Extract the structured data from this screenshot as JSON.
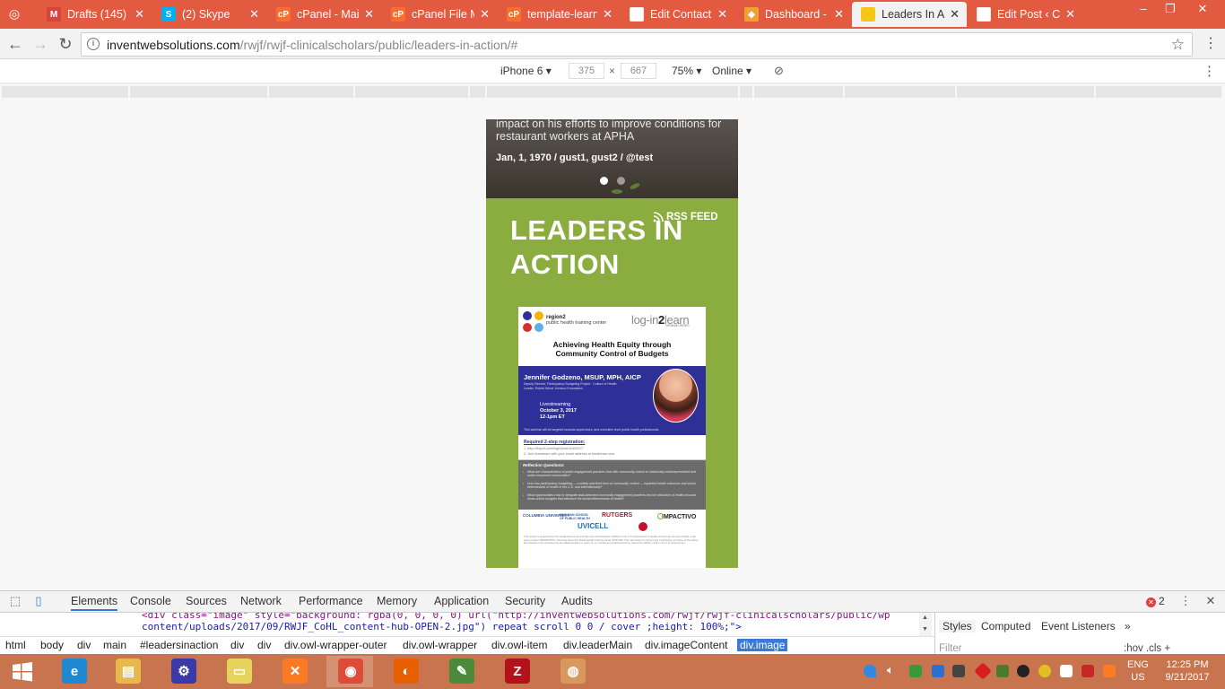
{
  "browser": {
    "tabs": [
      {
        "title": "Drafts (145)",
        "favicon": "gmail-icon",
        "color": "#d44638",
        "glyph": "M"
      },
      {
        "title": "(2) Skype",
        "favicon": "skype-icon",
        "color": "#00aff0",
        "glyph": "S"
      },
      {
        "title": "cPanel - Main",
        "favicon": "cpanel-icon",
        "color": "#ff6c2c",
        "glyph": "cP"
      },
      {
        "title": "cPanel File Manager",
        "favicon": "cpanel-icon",
        "color": "#ff6c2c",
        "glyph": "cP"
      },
      {
        "title": "template-learn",
        "favicon": "cpanel-icon",
        "color": "#ff6c2c",
        "glyph": "cP"
      },
      {
        "title": "Edit Contact",
        "favicon": "page-icon",
        "color": "#ffffff",
        "glyph": ""
      },
      {
        "title": "Dashboard -",
        "favicon": "dashboard-icon",
        "color": "#f0a030",
        "glyph": "◆"
      },
      {
        "title": "Leaders In Action",
        "favicon": "page-yellow-icon",
        "color": "#f5c518",
        "glyph": "",
        "active": true
      },
      {
        "title": "Edit Post ‹ Cl",
        "favicon": "page-icon",
        "color": "#ffffff",
        "glyph": ""
      }
    ],
    "url_host": "inventwebsolutions.com",
    "url_path": "/rwjf/rwjf-clinicalscholars/public/leaders-in-action/#"
  },
  "device_toolbar": {
    "device": "iPhone 6",
    "width": "375",
    "height": "667",
    "zoom": "75%",
    "network": "Online"
  },
  "page": {
    "hero_caption": "impact on his efforts to improve conditions for restaurant workers at APHA",
    "hero_meta": "Jan, 1, 1970  /  gust1, gust2  /  @test",
    "section_title": "LEADERS IN ACTION",
    "rss_label": "RSS FEED",
    "colors": {
      "green": "#8bad3f",
      "flyer_blue": "#2e3097"
    }
  },
  "flyer": {
    "org_name": "region2",
    "org_sub": "public health training center",
    "series_pre": "log-in",
    "series_num": "2",
    "series_post": "learn",
    "series_tag": "WEBINAR SERIES",
    "headline_1": "Achieving Health Equity through",
    "headline_2": "Community Control of Budgets",
    "speaker": "Jennifer Godzeno, MSUP, MPH, AICP",
    "speaker_role": "Deputy Director, Participatory Budgeting Project · Culture of Health Leader, Robert Wood Johnson Foundation",
    "live_1": "Livestreaming",
    "live_2": "October 3, 2017",
    "live_3": "12-1pm ET",
    "audience_note": "This webinar will be targeted towards supervisors, and executive level public health professionals.",
    "reg_title": "Required 2-step registration:",
    "reg_1": "1. http://tinyurl.com/login2learnOct2017",
    "reg_2": "2. Join livestream with your email address at livestream.com",
    "questions_title": "Reflection Questions:",
    "questions": [
      "What are characteristics of public engagement practices that offer community control to historically underrepresented and under-resourced communities?",
      "How has participatory budgeting — a widely practiced form of community control — impacted health outcomes and social determinants of health in the U.S. and internationally?",
      "What opportunities exist to integrate data-informed community engagement practices into the allocation of health-focused funds and/or budgets that influence the social determinants of health?"
    ],
    "logos": [
      "COLUMBIA UNIVERSITY",
      "MAILMAN SCHOOL OF PUBLIC HEALTH",
      "RUTGERS",
      "UVICELL",
      "IMPACTIVO"
    ],
    "fine_print": "This project is supported by the Health Resources and Services Administration (HRSA) of the U.S. Department of Health and Human Services (HHS) under grant number UB6HP27876. Columbia University Public Health Training Center $750,000. The information or content and conclusions are those of the author and should not be construed as the official position or policy of, nor should any endorsements be inferred by HRSA, HHS or the U.S. Government."
  },
  "devtools": {
    "tabs": [
      "Elements",
      "Console",
      "Sources",
      "Network",
      "Performance",
      "Memory",
      "Application",
      "Security",
      "Audits"
    ],
    "selected_tab": "Elements",
    "error_count": "2",
    "code_line_1": "<div class=\"image\" style=\"background: rgba(0, 0, 0, 0) url(\"http://inventwebsolutions.com/rwjf/rwjf-clinicalscholars/public/wp",
    "code_line_2": "content/uploads/2017/09/RWJF_CoHL_content-hub-OPEN-2.jpg\") repeat scroll 0 0 / cover ;height: 100%;\">",
    "breadcrumbs": [
      "html",
      "body",
      "div",
      "main",
      "#leadersinaction",
      "div",
      "div",
      "div.owl-wrapper-outer",
      "div.owl-wrapper",
      "div.owl-item",
      "div.leaderMain",
      "div.imageContent",
      "div.image"
    ],
    "side_tabs": [
      "Styles",
      "Computed",
      "Event Listeners",
      "»"
    ],
    "filter_placeholder": "Filter",
    "filter_right": ":hov  .cls  +"
  },
  "taskbar": {
    "language_1": "ENG",
    "language_2": "US",
    "time": "12:25 PM",
    "date": "9/21/2017",
    "apps": [
      {
        "name": "internet-explorer-icon",
        "color": "#1e88d2",
        "glyph": "e"
      },
      {
        "name": "file-explorer-icon",
        "color": "#e8b84a",
        "glyph": "▤"
      },
      {
        "name": "settings-app-icon",
        "color": "#3a3aa8",
        "glyph": "⚙"
      },
      {
        "name": "folder-icon",
        "color": "#e6d35a",
        "glyph": "▭"
      },
      {
        "name": "xampp-icon",
        "color": "#fb7a24",
        "glyph": "✕"
      },
      {
        "name": "chrome-icon",
        "color": "#dd4b39",
        "glyph": "◉"
      },
      {
        "name": "firefox-icon",
        "color": "#e66000",
        "glyph": "◐"
      },
      {
        "name": "notepad-icon",
        "color": "#4a8a3a",
        "glyph": "✎"
      },
      {
        "name": "filezilla-icon",
        "color": "#b3121b",
        "glyph": "Z"
      },
      {
        "name": "paint-icon",
        "color": "#d89860",
        "glyph": "◍"
      }
    ]
  }
}
